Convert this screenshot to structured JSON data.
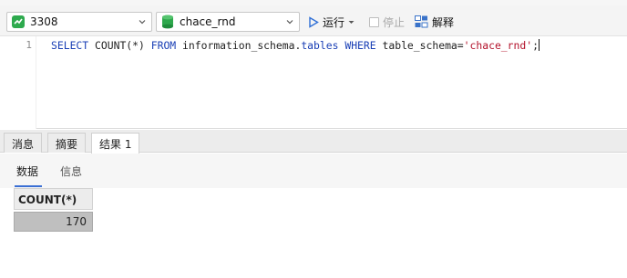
{
  "toolbar": {
    "connection": "3308",
    "database": "chace_rnd",
    "run_label": "运行",
    "stop_label": "停止",
    "explain_label": "解释"
  },
  "editor": {
    "line_number": "1",
    "sql_tokens": {
      "k1": "SELECT",
      "t1": " COUNT(*) ",
      "k2": "FROM",
      "t2": " information_schema.",
      "k3": "tables",
      "t3": " ",
      "k4": "WHERE",
      "t4": " table_schema=",
      "s1": "'chace_rnd'",
      "t5": ";"
    }
  },
  "result_tabs": [
    "消息",
    "摘要",
    "结果 1"
  ],
  "sub_tabs": [
    "数据",
    "信息"
  ],
  "result": {
    "columns": [
      "COUNT(*)"
    ],
    "rows": [
      [
        "170"
      ]
    ]
  },
  "colors": {
    "keyword": "#1a3fb5",
    "string": "#b3122b",
    "accent": "#3b6fd4"
  }
}
